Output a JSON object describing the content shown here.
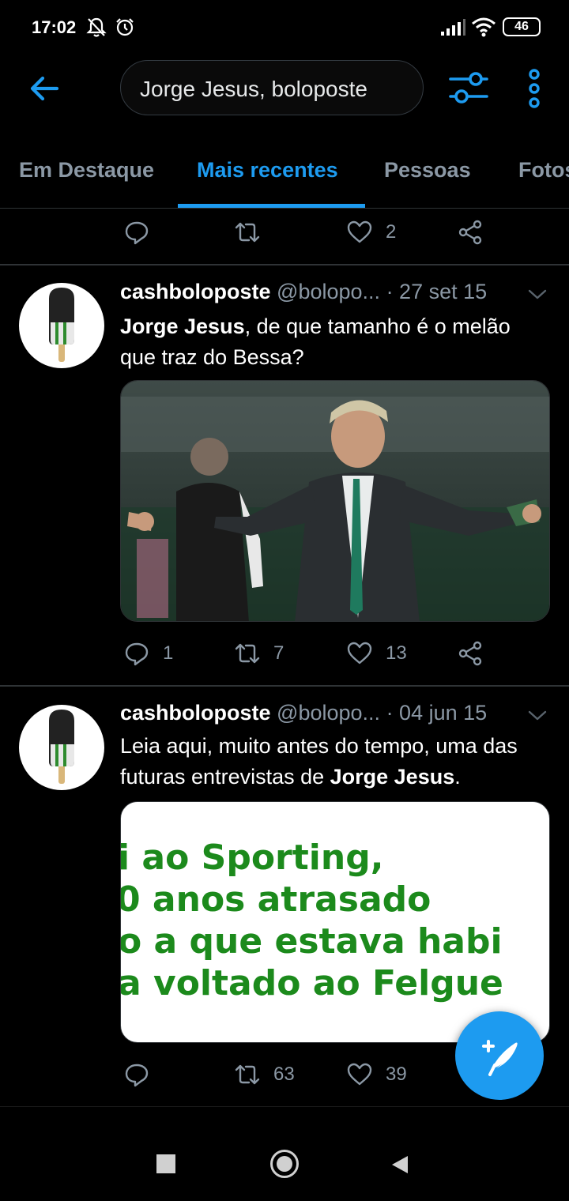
{
  "status_bar": {
    "time": "17:02",
    "battery": "46",
    "icons": [
      "notifications-off-icon",
      "alarm-icon",
      "signal-icon",
      "wifi-icon",
      "battery-icon"
    ]
  },
  "header": {
    "search_value": "Jorge Jesus, boloposte",
    "icons": [
      "back-arrow-icon",
      "filter-icon",
      "more-vertical-icon"
    ]
  },
  "colors": {
    "accent": "#1d9bf0",
    "muted": "#8b98a5",
    "divider": "#2f3336",
    "sporting_green": "#1c8a1c"
  },
  "tabs": [
    {
      "label": "Em Destaque",
      "active": false
    },
    {
      "label": "Mais recentes",
      "active": true
    },
    {
      "label": "Pessoas",
      "active": false
    },
    {
      "label": "Fotos",
      "active": false
    }
  ],
  "top_actions": {
    "reply": "",
    "retweet": "",
    "like": "2"
  },
  "tweets": [
    {
      "name": "cashboloposte",
      "handle": "@bolopo...",
      "date": "· 27 set 15",
      "text_bold": "Jorge Jesus",
      "text_rest": ", de que tamanho é o melão que traz do Bessa?",
      "media": "photo",
      "replies": "1",
      "retweets": "7",
      "likes": "13"
    },
    {
      "name": "cashboloposte",
      "handle": "@bolopo...",
      "date": "· 04 jun 15",
      "text_pre": "Leia aqui, muito antes do tempo, uma das futuras entrevistas de ",
      "text_bold": "Jorge Jesus",
      "text_post": ".",
      "media_lines": [
        "i ao Sporting,",
        "0 anos atrasado",
        "o a que estava habi",
        "a voltado ao Felgue"
      ],
      "replies": "",
      "retweets": "63",
      "likes": "39"
    }
  ],
  "fab_icon": "compose-tweet-icon",
  "navbar_icons": [
    "recents-square-icon",
    "home-circle-icon",
    "back-triangle-icon"
  ]
}
